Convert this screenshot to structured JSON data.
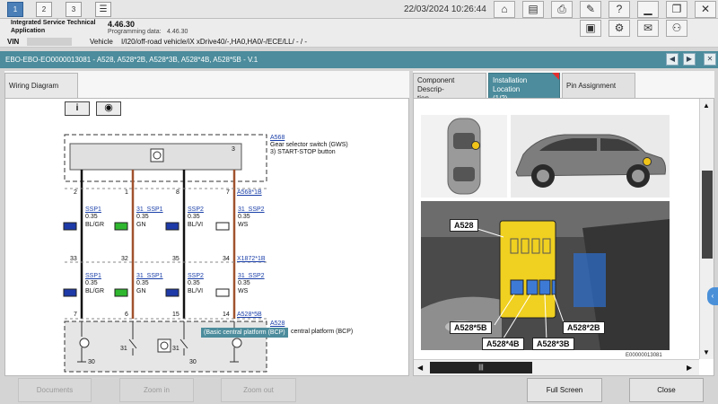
{
  "topbar": {
    "tabs": [
      "1",
      "2",
      "3"
    ],
    "datetime": "22/03/2024 10:26:44",
    "icons": [
      "home-icon",
      "card-icon",
      "printer-icon",
      "wrench-icon",
      "help-icon",
      "minimize-icon",
      "restore-icon",
      "close-icon"
    ]
  },
  "info": {
    "app_label_line1": "Integrated Service Technical",
    "app_label_line2": "Application",
    "version": "4.46.30",
    "programming_label": "Programming data:",
    "programming_value": "4.46.30",
    "vin_label": "VIN",
    "vehicle_label": "Vehicle",
    "vehicle_value": "I/I20/off-road vehicle/iX xDrive40/-,HA0,HA0/-/ECE/LL/ - / -"
  },
  "docbar": {
    "title": "EBO-EBO-EO0000013081 - A528, A528*2B, A528*3B, A528*4B, A528*5B - V.1"
  },
  "left": {
    "tab_wiring": "Wiring Diagram",
    "info_icon": "i",
    "comp_top_code": "A568",
    "comp_top_name": "Gear selector switch (GWS)",
    "comp_top_note": "3)   START-STOP button",
    "pin_3": "3",
    "connector_top": "A568*1B",
    "top_pins": [
      "2",
      "1",
      "8",
      "7"
    ],
    "row1": [
      {
        "sig": "SSP1",
        "size": "0.35",
        "color": "BL/GR"
      },
      {
        "sig": "31_SSP1",
        "size": "0.35",
        "color": "GN"
      },
      {
        "sig": "SSP2",
        "size": "0.35",
        "color": "BL/VI"
      },
      {
        "sig": "31_SSP2",
        "size": "0.35",
        "color": "WS"
      }
    ],
    "mid_pins": [
      "33",
      "32",
      "35",
      "34"
    ],
    "connector_mid": "X1872*1B",
    "row2": [
      {
        "sig": "SSP1",
        "size": "0.35",
        "color": "BL/GR"
      },
      {
        "sig": "31_SSP1",
        "size": "0.35",
        "color": "GN"
      },
      {
        "sig": "SSP2",
        "size": "0.35",
        "color": "BL/VI"
      },
      {
        "sig": "31_SSP2",
        "size": "0.35",
        "color": "WS"
      }
    ],
    "bottom_pins": [
      "7",
      "6",
      "15",
      "14"
    ],
    "connector_bottom": "A528*5B",
    "comp_bottom_code": "A528",
    "tooltip": "(Basic central platform (BCP)",
    "comp_bottom_name": "central platform (BCP)",
    "ground_labels": [
      "30",
      "31",
      "31",
      "30"
    ]
  },
  "right": {
    "tab_component": "Component Descrip-\ntion",
    "tab_install": "Installation Location\n(1/2)",
    "tab_pins": "Pin Assignment",
    "labels": {
      "main": "A528",
      "c5b": "A528*5B",
      "c2b": "A528*2B",
      "c4b": "A528*4B",
      "c3b": "A528*3B"
    },
    "image_id": "E00000013081",
    "scroll_thumb": "|||"
  },
  "bottom": {
    "documents": "Documents",
    "zoom_in": "Zoom in",
    "zoom_out": "Zoom out",
    "full_screen": "Full Screen",
    "close": "Close"
  },
  "colors": {
    "teal": "#4c8c9c",
    "yellow": "#f0d020",
    "wire_black": "#111111",
    "wire_brown": "#a0522d"
  }
}
